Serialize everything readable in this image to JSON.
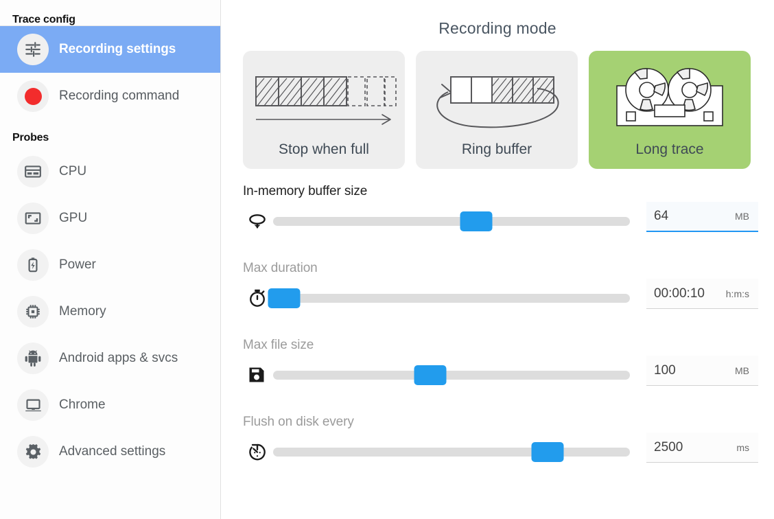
{
  "sidebar": {
    "title": "Trace config",
    "nav_items": [
      {
        "label": "Recording settings",
        "icon": "tune-sliders-icon",
        "selected": true
      },
      {
        "label": "Recording command",
        "icon": "record-dot-icon",
        "selected": false
      }
    ],
    "probes_heading": "Probes",
    "probes": [
      {
        "label": "CPU",
        "icon": "cpu-chip-icon"
      },
      {
        "label": "GPU",
        "icon": "gpu-display-icon"
      },
      {
        "label": "Power",
        "icon": "battery-bolt-icon"
      },
      {
        "label": "Memory",
        "icon": "memory-chip-icon"
      },
      {
        "label": "Android apps & svcs",
        "icon": "android-robot-icon"
      },
      {
        "label": "Chrome",
        "icon": "laptop-icon"
      },
      {
        "label": "Advanced settings",
        "icon": "gear-icon"
      }
    ]
  },
  "main": {
    "title": "Recording mode",
    "modes": [
      {
        "label": "Stop when full",
        "icon": "linear-buffer-arrow-icon",
        "selected": false
      },
      {
        "label": "Ring buffer",
        "icon": "ring-buffer-loop-icon",
        "selected": false
      },
      {
        "label": "Long trace",
        "icon": "tape-reel-icon",
        "selected": true
      }
    ],
    "sliders": [
      {
        "label": "In-memory buffer size",
        "icon": "loop-arrow-icon",
        "value": "64",
        "unit": "MB",
        "percent": 57,
        "active": true
      },
      {
        "label": "Max duration",
        "icon": "stopwatch-icon",
        "value": "00:00:10",
        "unit": "h:m:s",
        "percent": 3,
        "active": false
      },
      {
        "label": "Max file size",
        "icon": "floppy-disk-icon",
        "value": "100",
        "unit": "MB",
        "percent": 44,
        "active": false
      },
      {
        "label": "Flush on disk every",
        "icon": "timer-history-icon",
        "value": "2500",
        "unit": "ms",
        "percent": 77,
        "active": false
      }
    ]
  },
  "colors": {
    "accent_blue": "#229ced",
    "selected_nav": "#7babf4",
    "selected_card": "#a5d173",
    "record_red": "#f22c2c"
  }
}
